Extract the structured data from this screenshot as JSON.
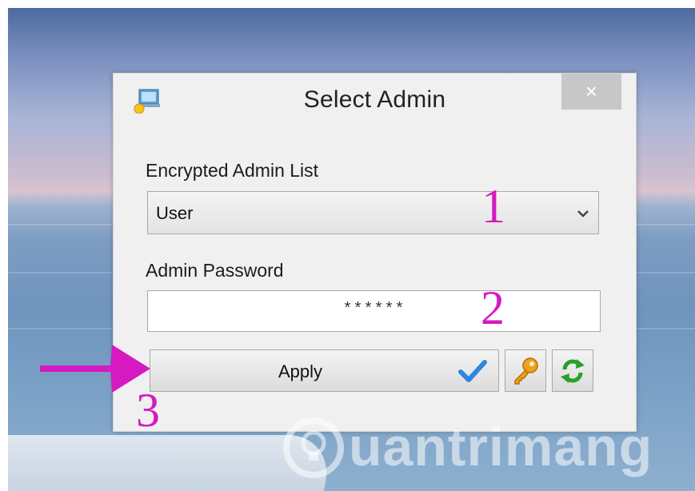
{
  "dialog": {
    "title": "Select Admin",
    "close_glyph": "×",
    "encrypted_label": "Encrypted Admin List",
    "selected_admin": "User",
    "password_label": "Admin Password",
    "password_value": "******",
    "apply_label": "Apply"
  },
  "annotations": {
    "one": "1",
    "two": "2",
    "three": "3"
  },
  "watermark": {
    "text": "uantrimang"
  },
  "icons": {
    "app": "admin-app-icon",
    "close": "close-icon",
    "dropdown": "chevron-down-icon",
    "apply_check": "checkmark-icon",
    "key": "key-icon",
    "refresh": "refresh-icon"
  },
  "colors": {
    "annotation": "#d619c0",
    "check": "#2e86de",
    "key": "#f0a020",
    "refresh": "#2aa02a"
  }
}
